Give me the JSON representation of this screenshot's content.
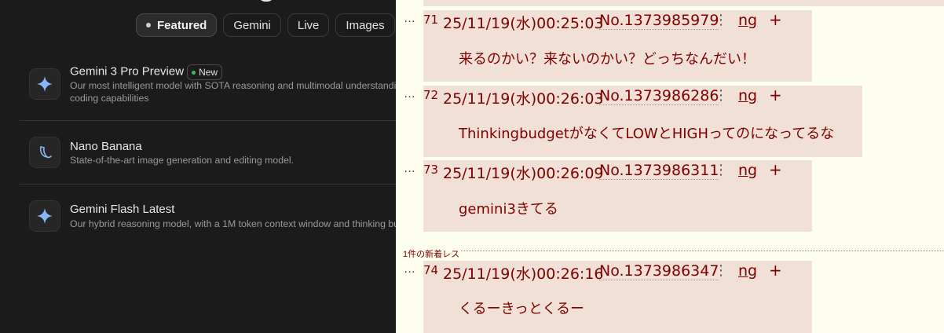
{
  "left": {
    "tabs": [
      "Featured",
      "Gemini",
      "Live",
      "Images"
    ],
    "models": [
      {
        "name": "Gemini 3 Pro Preview",
        "badge": "New",
        "desc_line1": "Our most intelligent model with SOTA reasoning and multimodal understanding,",
        "desc_line2": "coding capabilities",
        "icon": "sparkle-icon"
      },
      {
        "name": "Nano Banana",
        "desc_line1": "State-of-the-art image generation and editing model.",
        "icon": "banana-icon"
      },
      {
        "name": "Gemini Flash Latest",
        "desc_line1": "Our hybrid reasoning model, with a 1M token context window and thinking budg",
        "icon": "sparkle-icon"
      }
    ]
  },
  "right": {
    "new_label": "1件の新着レス",
    "posts": [
      {
        "ellipsis": "…",
        "num": "71",
        "datetime": "25/11/19(水)00:25:03",
        "no": "No.1373985979",
        "menu": "⋮",
        "ng": "ng",
        "plus": "+",
        "text": "来るのかい？来ないのかい？どっちなんだい！"
      },
      {
        "ellipsis": "…",
        "num": "72",
        "datetime": "25/11/19(水)00:26:03",
        "no": "No.1373986286",
        "menu": "⋮",
        "ng": "ng",
        "plus": "+",
        "text": "ThinkingbudgetがなくてLOWとHIGHってのになってるな"
      },
      {
        "ellipsis": "…",
        "num": "73",
        "datetime": "25/11/19(水)00:26:09",
        "no": "No.1373986311",
        "menu": "⋮",
        "ng": "ng",
        "plus": "+",
        "text": "gemini3きてる"
      },
      {
        "ellipsis": "…",
        "num": "74",
        "datetime": "25/11/19(水)00:26:16",
        "no": "No.1373986347",
        "menu": "⋮",
        "ng": "ng",
        "plus": "+",
        "text": "くるーきっとくるー"
      }
    ]
  }
}
